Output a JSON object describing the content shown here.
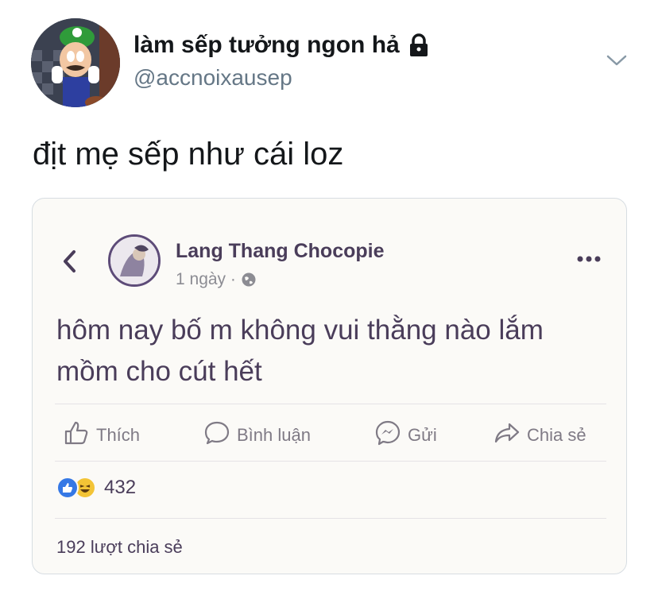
{
  "tweet": {
    "display_name": "làm sếp tưởng ngon hả",
    "handle": "@accnoixausep",
    "text": "địt mẹ sếp như cái loz"
  },
  "fb_post": {
    "page_name": "Lang Thang Chocopie",
    "time": "1 ngày ·",
    "text": "hôm nay bố m không vui thằng nào lắm mồm cho cút hết",
    "actions": {
      "like": "Thích",
      "comment": "Bình luận",
      "send": "Gửi",
      "share": "Chia sẻ"
    },
    "reaction_count": "432",
    "share_count": "192 lượt chia sẻ"
  },
  "colors": {
    "fb_text": "#4a3d5a",
    "handle": "#657786",
    "like_blue": "#3578e5"
  },
  "icons": [
    "lock-icon",
    "chevron-down-icon",
    "back-icon",
    "more-icon",
    "globe-icon",
    "thumbs-up-icon",
    "comment-icon",
    "messenger-icon",
    "share-icon"
  ]
}
